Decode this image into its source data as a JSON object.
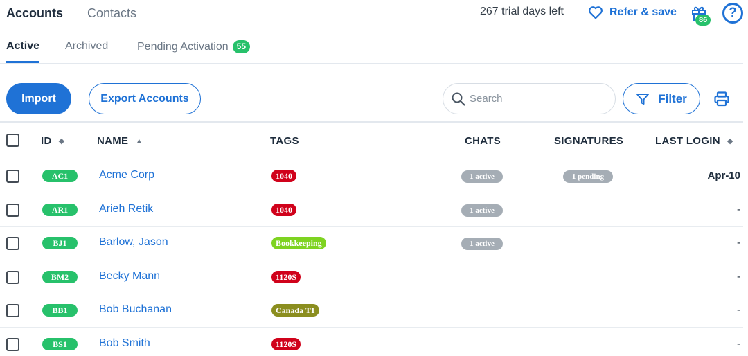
{
  "header": {
    "tabs": [
      "Accounts",
      "Contacts"
    ],
    "trial_text": "267 trial days left",
    "refer_label": "Refer & save",
    "gift_badge": "86",
    "help_icon": "?"
  },
  "subtabs": {
    "active": "Active",
    "archived": "Archived",
    "pending": "Pending Activation",
    "pending_count": "55"
  },
  "toolbar": {
    "import_label": "Import",
    "export_label": "Export Accounts",
    "search_placeholder": "Search",
    "filter_label": "Filter"
  },
  "columns": {
    "id": "ID",
    "name": "NAME",
    "tags": "TAGS",
    "chats": "CHATS",
    "signatures": "SIGNATURES",
    "last_login": "LAST LOGIN"
  },
  "colors": {
    "accent": "#1f72d6",
    "id_green": "#27c16b",
    "tag_red": "#d0021b",
    "tag_lime": "#7ed321",
    "tag_olive": "#8b8e1f",
    "pill_gray": "#a5adb5"
  },
  "rows": [
    {
      "id": "AC1",
      "name": "Acme Corp",
      "tag": "1040",
      "tag_color": "#d0021b",
      "chats": "1 active",
      "signatures": "1 pending",
      "last_login": "Apr-10"
    },
    {
      "id": "AR1",
      "name": "Arieh Retik",
      "tag": "1040",
      "tag_color": "#d0021b",
      "chats": "1 active",
      "signatures": "",
      "last_login": "-"
    },
    {
      "id": "BJ1",
      "name": "Barlow, Jason",
      "tag": "Bookkeeping",
      "tag_color": "#7ed321",
      "chats": "1 active",
      "signatures": "",
      "last_login": "-"
    },
    {
      "id": "BM2",
      "name": "Becky Mann",
      "tag": "1120S",
      "tag_color": "#d0021b",
      "chats": "",
      "signatures": "",
      "last_login": "-"
    },
    {
      "id": "BB1",
      "name": "Bob Buchanan",
      "tag": "Canada T1",
      "tag_color": "#8b8e1f",
      "chats": "",
      "signatures": "",
      "last_login": "-"
    },
    {
      "id": "BS1",
      "name": "Bob Smith",
      "tag": "1120S",
      "tag_color": "#d0021b",
      "chats": "",
      "signatures": "",
      "last_login": "-"
    }
  ]
}
